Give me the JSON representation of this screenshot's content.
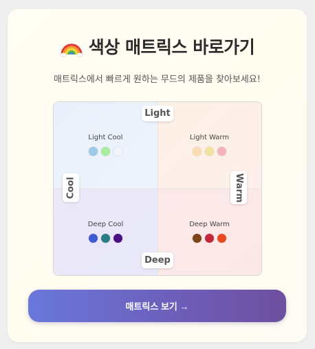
{
  "header": {
    "icon": "rainbow-icon",
    "title": "색상 매트릭스 바로가기",
    "subtitle": "매트릭스에서 빠르게 원하는 무드의 제품을 찾아보세요!"
  },
  "matrix": {
    "axes": {
      "top": "Light",
      "bottom": "Deep",
      "left": "Cool",
      "right": "Warm"
    },
    "quadrants": {
      "light_cool": {
        "label": "Light Cool",
        "swatches": [
          "#9ccbe6",
          "#a8ec9d",
          "#f4f4f8"
        ]
      },
      "light_warm": {
        "label": "Light Warm",
        "swatches": [
          "#fbdcb0",
          "#f1e2a0",
          "#f3b4bf"
        ]
      },
      "deep_cool": {
        "label": "Deep Cool",
        "swatches": [
          "#3f5bd1",
          "#2b7d83",
          "#4b0f85"
        ]
      },
      "deep_warm": {
        "label": "Deep Warm",
        "swatches": [
          "#7b4419",
          "#c4283d",
          "#e84a22"
        ]
      }
    }
  },
  "cta": {
    "label": "매트릭스 보기 →"
  },
  "colors": {
    "accent_start": "#6a78db",
    "accent_end": "#6e4f9f"
  }
}
